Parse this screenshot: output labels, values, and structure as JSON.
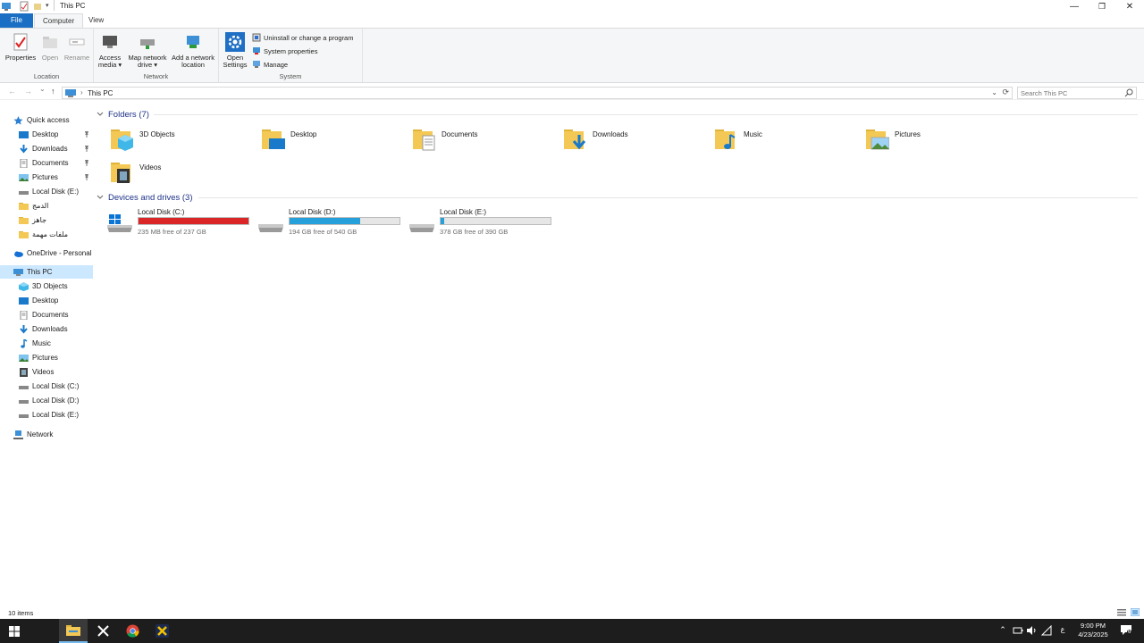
{
  "window": {
    "title": "This PC",
    "controls": {
      "minimize": "—",
      "maximize": "❐",
      "close": "✕"
    }
  },
  "ribbon_tabs": [
    {
      "label": "File"
    },
    {
      "label": "Computer"
    },
    {
      "label": "View"
    }
  ],
  "ribbon": {
    "location": {
      "name": "Location",
      "buttons": [
        {
          "label": "Properties"
        },
        {
          "label": "Open"
        },
        {
          "label": "Rename"
        }
      ]
    },
    "network": {
      "name": "Network",
      "buttons": [
        {
          "label1": "Access",
          "label2": "media ▾"
        },
        {
          "label1": "Map network",
          "label2": "drive ▾"
        },
        {
          "label1": "Add a network",
          "label2": "location"
        }
      ]
    },
    "system": {
      "name": "System",
      "open_settings": {
        "label1": "Open",
        "label2": "Settings"
      },
      "small_buttons": [
        {
          "label": "Uninstall or change a program"
        },
        {
          "label": "System properties"
        },
        {
          "label": "Manage"
        }
      ]
    }
  },
  "nav": {
    "back": "←",
    "forward": "→",
    "recent": "⌄",
    "up": "↑",
    "path_sep": "›",
    "breadcrumb": "This PC",
    "dropdown": "⌄",
    "refresh": "⟳",
    "search_placeholder": "Search This PC"
  },
  "sidebar": {
    "quick_access": "Quick access",
    "quick_items": [
      {
        "label": "Desktop",
        "pinned": true
      },
      {
        "label": "Downloads",
        "pinned": true
      },
      {
        "label": "Documents",
        "pinned": true
      },
      {
        "label": "Pictures",
        "pinned": true
      },
      {
        "label": "Local Disk (E:)",
        "pinned": false
      },
      {
        "label": "الدمج",
        "pinned": false
      },
      {
        "label": "جاهز",
        "pinned": false
      },
      {
        "label": "ملفات مهمة",
        "pinned": false
      }
    ],
    "onedrive": "OneDrive - Personal",
    "this_pc": "This PC",
    "pc_items": [
      {
        "label": "3D Objects"
      },
      {
        "label": "Desktop"
      },
      {
        "label": "Documents"
      },
      {
        "label": "Downloads"
      },
      {
        "label": "Music"
      },
      {
        "label": "Pictures"
      },
      {
        "label": "Videos"
      },
      {
        "label": "Local Disk (C:)"
      },
      {
        "label": "Local Disk (D:)"
      },
      {
        "label": "Local Disk (E:)"
      }
    ],
    "network": "Network"
  },
  "content": {
    "folders_header": "Folders (7)",
    "folders": [
      {
        "label": "3D Objects"
      },
      {
        "label": "Desktop"
      },
      {
        "label": "Documents"
      },
      {
        "label": "Downloads"
      },
      {
        "label": "Music"
      },
      {
        "label": "Pictures"
      },
      {
        "label": "Videos"
      }
    ],
    "drives_header": "Devices and drives (3)",
    "drives": [
      {
        "label": "Local Disk (C:)",
        "free": "235 MB free of 237 GB",
        "used_fraction": 0.999,
        "bar_color": "#da2626"
      },
      {
        "label": "Local Disk (D:)",
        "free": "194 GB free of 540 GB",
        "used_fraction": 0.64,
        "bar_color": "#26a0da"
      },
      {
        "label": "Local Disk (E:)",
        "free": "378 GB free of 390 GB",
        "used_fraction": 0.03,
        "bar_color": "#26a0da"
      }
    ]
  },
  "status": {
    "item_count": "10 items"
  },
  "taskbar": {
    "clock_time": "9:00 PM",
    "clock_date": "4/23/2025",
    "tray_lang": "ع",
    "notification_count": "6"
  }
}
